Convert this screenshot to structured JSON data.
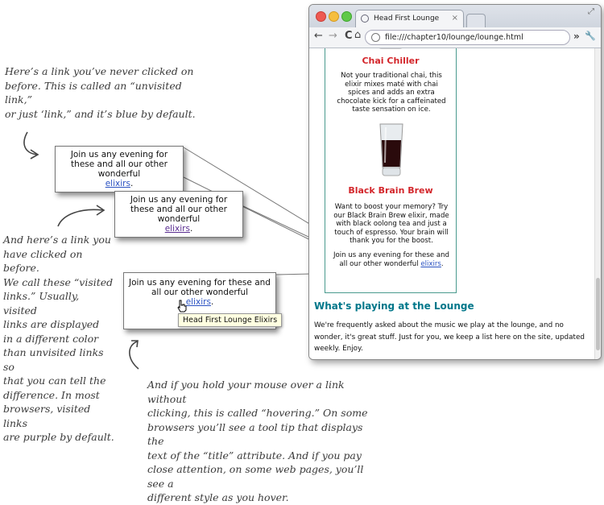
{
  "notes": {
    "unvisited": "Here’s a link you’ve never clicked on\nbefore. This is called an “unvisited link,”\nor just ‘link,” and it’s blue by default.",
    "visited": "And here’s a link you\nhave clicked on before.\nWe call these “visited\nlinks.” Usually, visited\nlinks are displayed\nin a different color\nthan unvisited links so\nthat you can tell the\ndifference. In most\nbrowsers, visited links\nare purple by default.",
    "hover": "And if you hold your mouse over a link without\nclicking, this is called “hovering.” On some\nbrowsers you’ll see a tool tip that displays the\ntext of the “title” attribute. And if you pay\nclose attention, on some web pages, you’ll see a\ndifferent style as you hover."
  },
  "callouts": {
    "text": "Join us any evening for these and all our other wonderful",
    "link": "elixirs",
    "period": "."
  },
  "tooltip": "Head First Lounge Elixirs",
  "colors": {
    "unvisited": "#2a52c2",
    "visited": "#5a2d91",
    "hover": "#2a52c2"
  },
  "browser": {
    "tab_title": "Head First Lounge",
    "tab_close": "×",
    "url": "file:///chapter10/lounge/lounge.html",
    "icons": [
      "back-icon",
      "forward-icon",
      "reload-icon",
      "home-icon",
      "more-icon",
      "wrench-icon"
    ],
    "back": "←",
    "forward": "→",
    "reload": "C",
    "home": "⌂",
    "more": "»",
    "wrench": "🔧"
  },
  "page": {
    "drink1_name": "Chai Chiller",
    "drink1_desc": "Not your traditional chai, this elixir mixes maté with chai spices and adds an extra chocolate kick for a caffeinated taste sensation on ice.",
    "drink2_name": "Black Brain Brew",
    "drink2_desc": "Want to boost your memory? Try our Black Brain Brew elixir, made with black oolong tea and just a touch of espresso. Your brain will thank you for the boost.",
    "join_text": "Join us any evening for these and all our other wonderful",
    "join_link": "elixirs",
    "join_period": ".",
    "section_heading": "What's playing at the Lounge",
    "section_text": "We're frequently asked about the music we play at the lounge, and no wonder, it's great stuff. Just for you, we keep a list here on the site, updated weekly. Enjoy."
  }
}
